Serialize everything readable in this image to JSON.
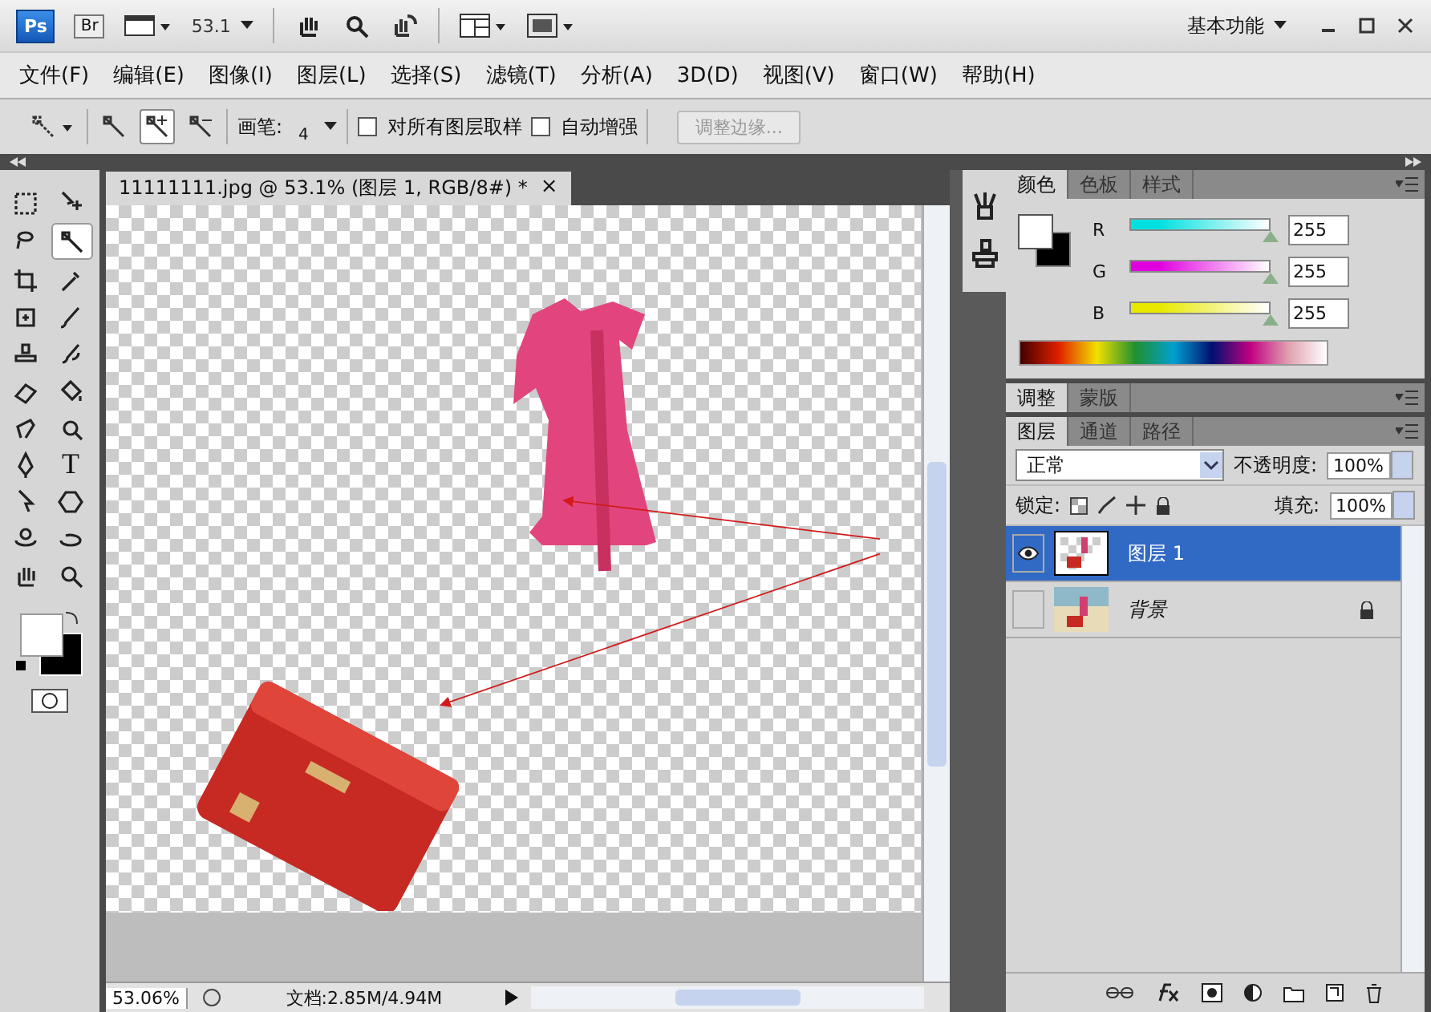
{
  "app_bar": {
    "ps_logo": "Ps",
    "br_logo": "Br",
    "zoom": "53.1",
    "workspace": "基本功能"
  },
  "menu": [
    "文件(F)",
    "编辑(E)",
    "图像(I)",
    "图层(L)",
    "选择(S)",
    "滤镜(T)",
    "分析(A)",
    "3D(D)",
    "视图(V)",
    "窗口(W)",
    "帮助(H)"
  ],
  "options_bar": {
    "modes": [
      {
        "kind": "new",
        "selected": false
      },
      {
        "kind": "add",
        "selected": true
      },
      {
        "kind": "subtract",
        "selected": false
      }
    ],
    "brush_label": "画笔:",
    "brush_size": "4",
    "sample_all": {
      "label": "对所有图层取样",
      "checked": false
    },
    "auto_enhance": {
      "label": "自动增强",
      "checked": false
    },
    "refine_edge": {
      "label": "调整边缘...",
      "disabled": true
    }
  },
  "tools": [
    {
      "kind": "marquee",
      "selected": false
    },
    {
      "kind": "move",
      "selected": false
    },
    {
      "kind": "lasso",
      "selected": false
    },
    {
      "kind": "wand",
      "selected": true
    },
    {
      "kind": "crop",
      "selected": false
    },
    {
      "kind": "eyedropper",
      "selected": false
    },
    {
      "kind": "heal",
      "selected": false
    },
    {
      "kind": "brush",
      "selected": false
    },
    {
      "kind": "stamp",
      "selected": false
    },
    {
      "kind": "history",
      "selected": false
    },
    {
      "kind": "eraser",
      "selected": false
    },
    {
      "kind": "bucket",
      "selected": false
    },
    {
      "kind": "smudge",
      "selected": false
    },
    {
      "kind": "dodge",
      "selected": false
    },
    {
      "kind": "pen",
      "selected": false
    },
    {
      "kind": "type",
      "selected": false
    },
    {
      "kind": "select",
      "selected": false
    },
    {
      "kind": "shape",
      "selected": false
    },
    {
      "kind": "rotate3d",
      "selected": false
    },
    {
      "kind": "orbit3d",
      "selected": false
    },
    {
      "kind": "hand",
      "selected": false
    },
    {
      "kind": "zoom",
      "selected": false
    }
  ],
  "type_tool_glyph": "T",
  "document": {
    "tab_title": "11111111.jpg @ 53.1% (图层 1, RGB/8#) *",
    "close": "×"
  },
  "status_bar": {
    "zoom": "53.06%",
    "doc_size": "文档:2.85M/4.94M"
  },
  "color_panel": {
    "tabs": [
      {
        "label": "颜色",
        "selected": true
      },
      {
        "label": "色板",
        "selected": false
      },
      {
        "label": "样式",
        "selected": false
      }
    ],
    "channels": [
      {
        "name": "R",
        "level": 1,
        "value": "255",
        "color": "#00e0e0"
      },
      {
        "name": "G",
        "level": 1,
        "value": "255",
        "color": "#e000e0"
      },
      {
        "name": "B",
        "level": 1,
        "value": "255",
        "color": "#e8e800"
      }
    ]
  },
  "adjust_panel": {
    "tabs": [
      {
        "label": "调整",
        "selected": true
      },
      {
        "label": "蒙版",
        "selected": false
      }
    ]
  },
  "layers_panel": {
    "tabs": [
      {
        "label": "图层",
        "selected": true
      },
      {
        "label": "通道",
        "selected": false
      },
      {
        "label": "路径",
        "selected": false
      }
    ],
    "blend_mode": "正常",
    "opacity_label": "不透明度:",
    "opacity": "100%",
    "lock_label": "锁定:",
    "fill_label": "填充:",
    "fill": "100%",
    "layers": [
      {
        "name": "图层 1",
        "selected": true,
        "visible": true,
        "locked": false
      },
      {
        "name": "背景",
        "selected": false,
        "visible": false,
        "locked": true
      }
    ]
  }
}
